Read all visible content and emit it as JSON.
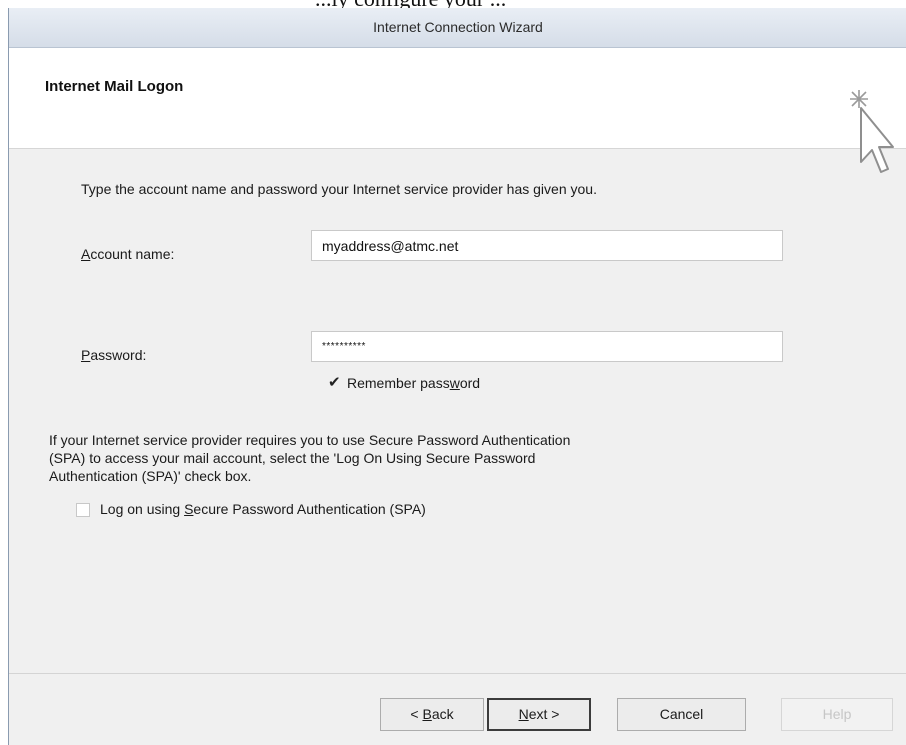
{
  "caption_fragment": "...ly configure your ...",
  "window": {
    "title": "Internet Connection Wizard"
  },
  "header": {
    "title": "Internet Mail Logon",
    "icon": "cursor-sparkle-icon"
  },
  "instructions": "Type the account name and password your Internet service provider has given you.",
  "account": {
    "label_prefix": "",
    "label_mnemonic": "A",
    "label_rest": "ccount name:",
    "value": "myaddress@atmc.net"
  },
  "password": {
    "label_prefix": "",
    "label_mnemonic": "P",
    "label_rest": "assword:",
    "value": "**********"
  },
  "remember": {
    "label_prefix": "Remember pass",
    "label_mnemonic": "w",
    "label_rest": "ord",
    "checked": true
  },
  "spa": {
    "info_line1": "If your Internet service provider requires you to use Secure Password Authentication",
    "info_line2": "(SPA) to access your mail account, select the 'Log On Using Secure Password",
    "info_line3": "Authentication (SPA)' check box.",
    "checkbox_prefix": "Log on using ",
    "checkbox_mnemonic": "S",
    "checkbox_rest": "ecure Password Authentication (SPA)",
    "checked": false
  },
  "buttons": {
    "back_prefix": "< ",
    "back_mnemonic": "B",
    "back_rest": "ack",
    "next_prefix": "",
    "next_mnemonic": "N",
    "next_rest": "ext >",
    "cancel": "Cancel",
    "help": "Help"
  }
}
